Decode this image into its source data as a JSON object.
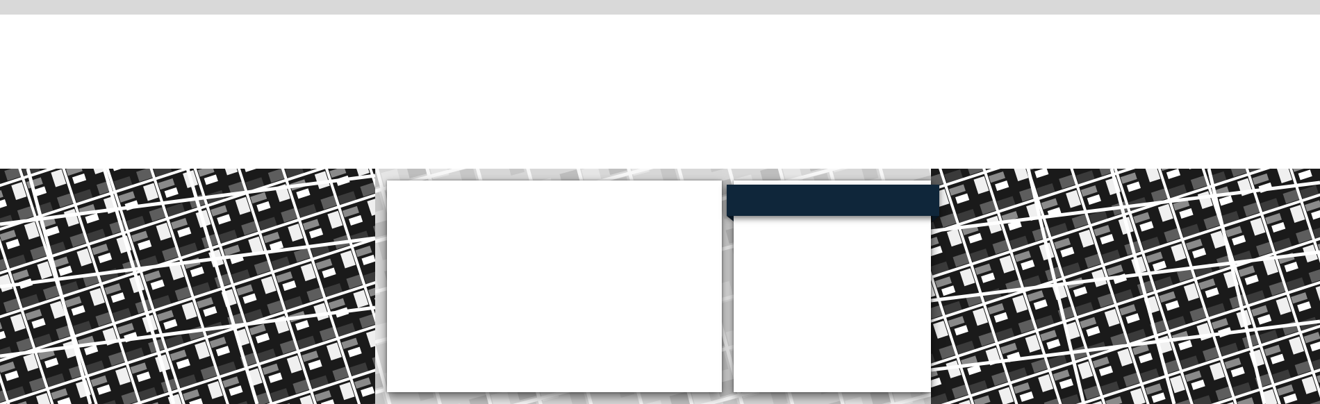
{
  "page": {
    "colors": {
      "top_bar": "#d9d9d9",
      "background": "#ffffff",
      "ribbon": "#0f263a",
      "card": "#ffffff"
    },
    "left_card": {
      "content": ""
    },
    "right_card": {
      "ribbon_label": "",
      "content": ""
    },
    "hero": {
      "description_icon": "city-map-background"
    }
  }
}
